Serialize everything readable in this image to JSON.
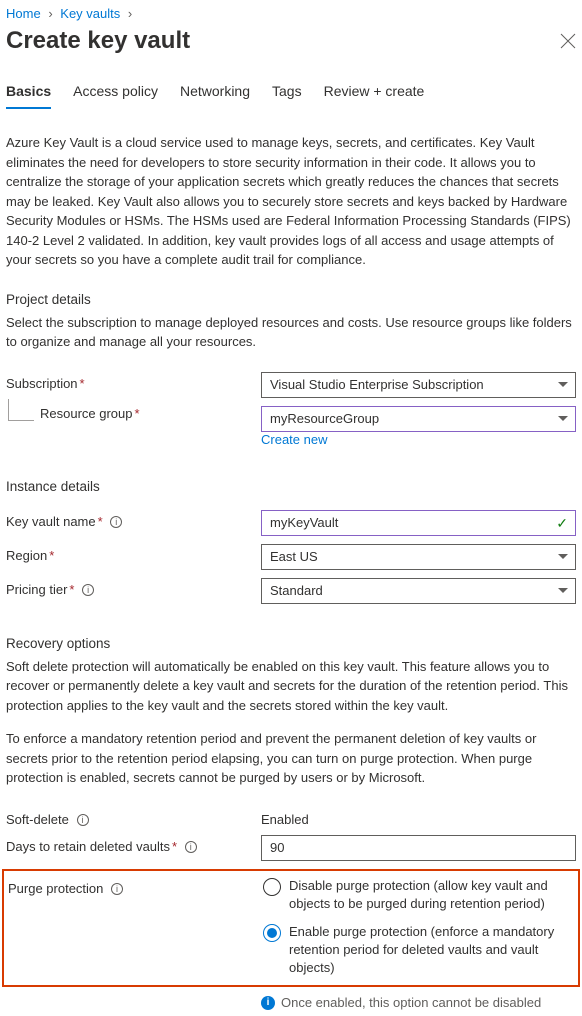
{
  "breadcrumb": {
    "home": "Home",
    "keyvaults": "Key vaults"
  },
  "title": "Create key vault",
  "tabs": {
    "basics": "Basics",
    "access": "Access policy",
    "networking": "Networking",
    "tags": "Tags",
    "review": "Review + create"
  },
  "intro": "Azure Key Vault is a cloud service used to manage keys, secrets, and certificates. Key Vault eliminates the need for developers to store security information in their code. It allows you to centralize the storage of your application secrets which greatly reduces the chances that secrets may be leaked. Key Vault also allows you to securely store secrets and keys backed by Hardware Security Modules or HSMs. The HSMs used are Federal Information Processing Standards (FIPS) 140-2 Level 2 validated. In addition, key vault provides logs of all access and usage attempts of your secrets so you have a complete audit trail for compliance.",
  "project": {
    "heading": "Project details",
    "desc": "Select the subscription to manage deployed resources and costs. Use resource groups like folders to organize and manage all your resources.",
    "subscription_label": "Subscription",
    "subscription_value": "Visual Studio Enterprise Subscription",
    "rg_label": "Resource group",
    "rg_value": "myResourceGroup",
    "create_new": "Create new"
  },
  "instance": {
    "heading": "Instance details",
    "name_label": "Key vault name",
    "name_value": "myKeyVault",
    "region_label": "Region",
    "region_value": "East US",
    "tier_label": "Pricing tier",
    "tier_value": "Standard"
  },
  "recovery": {
    "heading": "Recovery options",
    "desc1": "Soft delete protection will automatically be enabled on this key vault. This feature allows you to recover or permanently delete a key vault and secrets for the duration of the retention period. This protection applies to the key vault and the secrets stored within the key vault.",
    "desc2": "To enforce a mandatory retention period and prevent the permanent deletion of key vaults or secrets prior to the retention period elapsing, you can turn on purge protection. When purge protection is enabled, secrets cannot be purged by users or by Microsoft.",
    "softdelete_label": "Soft-delete",
    "softdelete_value": "Enabled",
    "days_label": "Days to retain deleted vaults",
    "days_value": "90",
    "purge_label": "Purge protection",
    "purge_opt1": "Disable purge protection (allow key vault and objects to be purged during retention period)",
    "purge_opt2": "Enable purge protection (enforce a mandatory retention period for deleted vaults and vault objects)",
    "purge_info": "Once enabled, this option cannot be disabled"
  }
}
